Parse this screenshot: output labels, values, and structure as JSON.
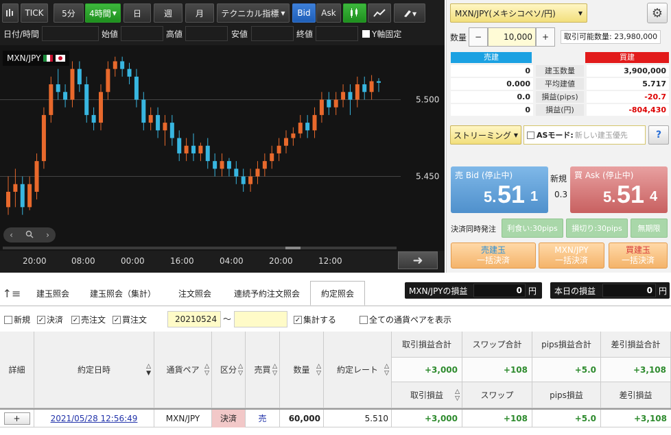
{
  "toolbar": {
    "tick": "TICK",
    "m5": "5分",
    "h4": "4時間",
    "day": "日",
    "week": "週",
    "month": "月",
    "technical": "テクニカル指標",
    "bid": "Bid",
    "ask": "Ask"
  },
  "ohlc_labels": {
    "datetime": "日付/時間",
    "open": "始値",
    "high": "高値",
    "low": "安値",
    "close": "終値",
    "yfix": "Y軸固定"
  },
  "chart": {
    "pair": "MXN/JPY",
    "y_labels": [
      "5.500",
      "5.450"
    ],
    "x_labels": [
      "20:00",
      "08:00",
      "00:00",
      "16:00",
      "04:00",
      "20:00",
      "12:00"
    ]
  },
  "chart_data": {
    "type": "candlestick",
    "ylim": [
      5.415,
      5.531
    ],
    "colors": {
      "up": "#e8692c",
      "down": "#38b6e0"
    },
    "candles": [
      [
        5.43,
        5.44,
        5.425,
        5.45
      ],
      [
        5.44,
        5.445,
        5.43,
        5.455
      ],
      [
        5.445,
        5.43,
        5.425,
        5.45
      ],
      [
        5.43,
        5.445,
        5.428,
        5.45
      ],
      [
        5.44,
        5.46,
        5.435,
        5.465
      ],
      [
        5.46,
        5.49,
        5.455,
        5.495
      ],
      [
        5.49,
        5.51,
        5.485,
        5.515
      ],
      [
        5.51,
        5.505,
        5.5,
        5.52
      ],
      [
        5.505,
        5.5,
        5.495,
        5.51
      ],
      [
        5.5,
        5.52,
        5.495,
        5.525
      ],
      [
        5.52,
        5.51,
        5.505,
        5.525
      ],
      [
        5.51,
        5.49,
        5.485,
        5.515
      ],
      [
        5.49,
        5.485,
        5.48,
        5.495
      ],
      [
        5.485,
        5.505,
        5.48,
        5.51
      ],
      [
        5.505,
        5.52,
        5.5,
        5.525
      ],
      [
        5.52,
        5.525,
        5.515,
        5.528
      ],
      [
        5.525,
        5.52,
        5.515,
        5.528
      ],
      [
        5.52,
        5.515,
        5.51,
        5.524
      ],
      [
        5.515,
        5.5,
        5.495,
        5.52
      ],
      [
        5.5,
        5.485,
        5.48,
        5.505
      ],
      [
        5.485,
        5.49,
        5.48,
        5.495
      ],
      [
        5.49,
        5.48,
        5.475,
        5.495
      ],
      [
        5.48,
        5.485,
        5.47,
        5.49
      ],
      [
        5.485,
        5.475,
        5.47,
        5.49
      ],
      [
        5.475,
        5.465,
        5.46,
        5.48
      ],
      [
        5.465,
        5.47,
        5.46,
        5.475
      ],
      [
        5.47,
        5.465,
        5.46,
        5.478
      ],
      [
        5.465,
        5.47,
        5.46,
        5.472
      ],
      [
        5.47,
        5.46,
        5.455,
        5.475
      ],
      [
        5.46,
        5.455,
        5.45,
        5.465
      ],
      [
        5.455,
        5.46,
        5.45,
        5.465
      ],
      [
        5.46,
        5.455,
        5.45,
        5.462
      ],
      [
        5.455,
        5.45,
        5.445,
        5.46
      ],
      [
        5.45,
        5.445,
        5.44,
        5.455
      ],
      [
        5.445,
        5.45,
        5.44,
        5.455
      ],
      [
        5.45,
        5.455,
        5.445,
        5.46
      ],
      [
        5.455,
        5.46,
        5.45,
        5.465
      ],
      [
        5.46,
        5.465,
        5.455,
        5.47
      ],
      [
        5.465,
        5.47,
        5.46,
        5.475
      ],
      [
        5.47,
        5.475,
        5.465,
        5.48
      ],
      [
        5.475,
        5.478,
        5.47,
        5.482
      ],
      [
        5.478,
        5.485,
        5.475,
        5.49
      ],
      [
        5.485,
        5.48,
        5.475,
        5.49
      ],
      [
        5.48,
        5.49,
        5.475,
        5.495
      ],
      [
        5.49,
        5.5,
        5.485,
        5.505
      ],
      [
        5.5,
        5.495,
        5.49,
        5.505
      ],
      [
        5.495,
        5.5,
        5.49,
        5.505
      ],
      [
        5.5,
        5.505,
        5.495,
        5.51
      ],
      [
        5.505,
        5.5,
        5.49,
        5.51
      ],
      [
        5.5,
        5.51,
        5.495,
        5.515
      ],
      [
        5.51,
        5.505,
        5.5,
        5.515
      ],
      [
        5.505,
        5.512,
        5.5,
        5.516
      ],
      [
        5.512,
        5.511,
        5.505,
        5.514
      ]
    ]
  },
  "order": {
    "pair_select": "MXN/JPY(メキシコペソ/円)",
    "qty_label": "数量",
    "qty_minus": "−",
    "qty_value": "10,000",
    "qty_plus": "+",
    "tradable": "取引可能数量: 23,980,000",
    "sell_header": "売建",
    "buy_header": "買建",
    "rows": [
      {
        "sell": "0",
        "label": "建玉数量",
        "buy": "3,900,000"
      },
      {
        "sell": "0.000",
        "label": "平均建値",
        "buy": "5.717"
      },
      {
        "sell": "0.0",
        "label": "損益(pips)",
        "buy": "-20.7"
      },
      {
        "sell": "0",
        "label": "損益(円)",
        "buy": "-804,430"
      }
    ],
    "streaming": "ストリーミング",
    "as_mode": "ASモード:",
    "as_mode_value": "新しい建玉優先",
    "help": "?",
    "sell_label": "売 Bid (停止中)",
    "sell_prefix": "5.",
    "sell_big": "51",
    "sell_suffix": "1",
    "new_label": "新規",
    "spread": "0.3",
    "buy_label": "買 Ask (停止中)",
    "buy_prefix": "5.",
    "buy_big": "51",
    "buy_suffix": "4",
    "settle_label": "決済同時発注",
    "take_profit": "利食い:30pips",
    "stop_loss": "損切り:30pips",
    "unlimited": "無期限",
    "bulk_sell_1": "売建玉",
    "bulk_sell_2": "一括決済",
    "bulk_pair_1": "MXN/JPY",
    "bulk_pair_2": "一括決済",
    "bulk_buy_1": "買建玉",
    "bulk_buy_2": "一括決済"
  },
  "tabs": [
    "建玉照会",
    "建玉照会（集計）",
    "注文照会",
    "連続予約注文照会",
    "約定照会"
  ],
  "pl_summary": {
    "pair_label": "MXN/JPYの損益",
    "pair_value": "0",
    "pair_unit": "円",
    "today_label": "本日の損益",
    "today_value": "0",
    "today_unit": "円"
  },
  "filters": {
    "new": "新規",
    "settle": "決済",
    "sell": "売注文",
    "buy": "買注文",
    "date_from": "20210524",
    "tilde": "〜",
    "aggregate": "集計する",
    "all_pairs": "全ての通貨ペアを表示"
  },
  "table": {
    "headers": {
      "detail": "詳細",
      "datetime": "約定日時",
      "pair": "通貨ペア",
      "kubun": "区分",
      "side": "売買",
      "qty": "数量",
      "rate": "約定レート",
      "total_pl": "取引損益合計",
      "swap_total": "スワップ合計",
      "pips_total": "pips損益合計",
      "net_total": "差引損益合計",
      "pl": "取引損益",
      "swap": "スワップ",
      "pips": "pips損益",
      "net": "差引損益"
    },
    "totals": {
      "total_pl": "+3,000",
      "swap": "+108",
      "pips": "+5.0",
      "net": "+3,108"
    },
    "rows": [
      {
        "detail": "+",
        "datetime": "2021/05/28 12:56:49",
        "pair": "MXN/JPY",
        "kubun": "決済",
        "side": "売",
        "qty": "60,000",
        "rate": "5.510",
        "pl": "+3,000",
        "swap": "+108",
        "pips": "+5.0",
        "net": "+3,108"
      }
    ]
  }
}
